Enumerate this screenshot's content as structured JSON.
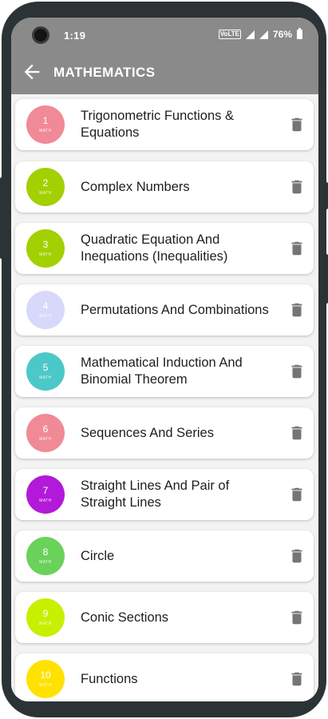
{
  "status_bar": {
    "time": "1:19",
    "network": "VoLTE",
    "battery": "76%"
  },
  "app_bar": {
    "title": "MATHEMATICS"
  },
  "chapters": [
    {
      "number": "1",
      "tag": "MATH",
      "title": "Trigonometric Functions & Equations",
      "color": "#f08a96"
    },
    {
      "number": "2",
      "tag": "MATH",
      "title": "Complex Numbers",
      "color": "#a3d000"
    },
    {
      "number": "3",
      "tag": "MATH",
      "title": "Quadratic Equation And Inequations (Inequalities)",
      "color": "#a3d000"
    },
    {
      "number": "4",
      "tag": "MATH",
      "title": "Permutations And Combinations",
      "color": "#d8d8fb"
    },
    {
      "number": "5",
      "tag": "MATH",
      "title": "Mathematical Induction And Binomial Theorem",
      "color": "#4cc8c8"
    },
    {
      "number": "6",
      "tag": "MATH",
      "title": "Sequences And Series",
      "color": "#f08a96"
    },
    {
      "number": "7",
      "tag": "MATH",
      "title": "Straight Lines And Pair of Straight Lines",
      "color": "#b219d8"
    },
    {
      "number": "8",
      "tag": "MATH",
      "title": "Circle",
      "color": "#6ad25a"
    },
    {
      "number": "9",
      "tag": "MATH",
      "title": "Conic Sections",
      "color": "#c6f000"
    },
    {
      "number": "10",
      "tag": "MATH",
      "title": "Functions",
      "color": "#ffe200"
    }
  ],
  "icons": {
    "back": "arrow-left-icon",
    "delete": "trash-icon"
  }
}
